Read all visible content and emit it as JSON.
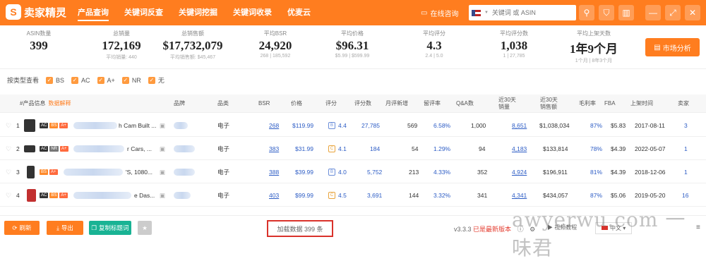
{
  "app": {
    "brand": "卖家精灵",
    "logo_letter": "S"
  },
  "nav": [
    "产品查询",
    "关键词反查",
    "关键词挖掘",
    "关键词收录",
    "优麦云"
  ],
  "consult": "在线咨询",
  "search": {
    "placeholder": "关键词 或 ASIN"
  },
  "stats": [
    {
      "label": "ASIN数量",
      "value": "399",
      "sub": ""
    },
    {
      "label": "总销量",
      "value": "172,169",
      "sub": "平均销量: 440"
    },
    {
      "label": "总销售额",
      "value": "$17,732,079",
      "sub": "平均销售额: $45,467"
    },
    {
      "label": "平均BSR",
      "value": "24,920",
      "sub": "268 | 185,592"
    },
    {
      "label": "平均价格",
      "value": "$96.31",
      "sub": "$5.99 | $599.99"
    },
    {
      "label": "平均评分",
      "value": "4.3",
      "sub": "2.4 | 5.0"
    },
    {
      "label": "平均评分数",
      "value": "1,038",
      "sub": "1 | 27,785"
    },
    {
      "label": "平均上架天数",
      "value": "1年9个月",
      "sub": "1个月 | 8年3个月"
    }
  ],
  "market_button": "市场分析",
  "filter": {
    "label": "按类型查看",
    "options": [
      "BS",
      "AC",
      "A+",
      "NR",
      "无"
    ]
  },
  "headers": {
    "product": "#产品信息",
    "copy": "数据解释",
    "brand": "品牌",
    "category": "品类",
    "bsr": "BSR",
    "price": "价格",
    "rating": "评分",
    "reviews": "评分数",
    "monthly_new": "月评新增",
    "review_rate": "留评率",
    "qa": "Q&A数",
    "sales30_a": "近30天",
    "sales30_b": "销量",
    "rev30_a": "近30天",
    "rev30_b": "销售额",
    "margin": "毛利率",
    "fba": "FBA",
    "listed": "上架时间",
    "sellers": "卖家"
  },
  "rows": [
    {
      "idx": "1",
      "badges": [
        "AC",
        "BS",
        "A+"
      ],
      "title": "h Cam Built ...",
      "category": "电子",
      "bsr": "268",
      "price": "$119.99",
      "rating_icon": "B",
      "rating": "4.4",
      "reviews": "27,785",
      "monthly_new": "569",
      "review_rate": "6.58%",
      "qa": "1,000",
      "sales30": "8,651",
      "rev30": "$1,038,034",
      "margin": "87%",
      "fba": "$5.83",
      "listed": "2017-08-11",
      "sellers": "3"
    },
    {
      "idx": "2",
      "badges": [
        "AC",
        "NR",
        "A+"
      ],
      "title": "r Cars, ...",
      "category": "电子",
      "bsr": "383",
      "price": "$31.99",
      "rating_icon": "C",
      "rating": "4.1",
      "reviews": "184",
      "monthly_new": "54",
      "review_rate": "1.29%",
      "qa": "94",
      "sales30": "4,183",
      "rev30": "$133,814",
      "margin": "78%",
      "fba": "$4.39",
      "listed": "2022-05-07",
      "sellers": "1"
    },
    {
      "idx": "3",
      "badges": [
        "BS",
        "A+"
      ],
      "title": "'S, 1080...",
      "category": "电子",
      "bsr": "388",
      "price": "$39.99",
      "rating_icon": "B",
      "rating": "4.0",
      "reviews": "5,752",
      "monthly_new": "213",
      "review_rate": "4.33%",
      "qa": "352",
      "sales30": "4,924",
      "rev30": "$196,911",
      "margin": "81%",
      "fba": "$4.39",
      "listed": "2018-12-06",
      "sellers": "1"
    },
    {
      "idx": "4",
      "badges": [
        "AC",
        "BS",
        "A+"
      ],
      "title": "e Das...",
      "category": "电子",
      "bsr": "403",
      "price": "$99.99",
      "rating_icon": "C",
      "rating": "4.5",
      "reviews": "3,691",
      "monthly_new": "144",
      "review_rate": "3.32%",
      "qa": "341",
      "sales30": "4,341",
      "rev30": "$434,057",
      "margin": "87%",
      "fba": "$5.06",
      "listed": "2019-05-20",
      "sellers": "16"
    }
  ],
  "footer": {
    "refresh": "刷新",
    "export": "导出",
    "copy_titles": "复制标题词",
    "loaded": "加载数据 399 条",
    "version": "v3.3.3",
    "latest": "已是最新版本",
    "tutorial": "视频教程",
    "language": "中文"
  },
  "watermark": "awyerwu.com 一味君",
  "colors": {
    "accent": "#ff7d1f",
    "link": "#2c5cc5",
    "highlight_border": "#d9322b"
  }
}
